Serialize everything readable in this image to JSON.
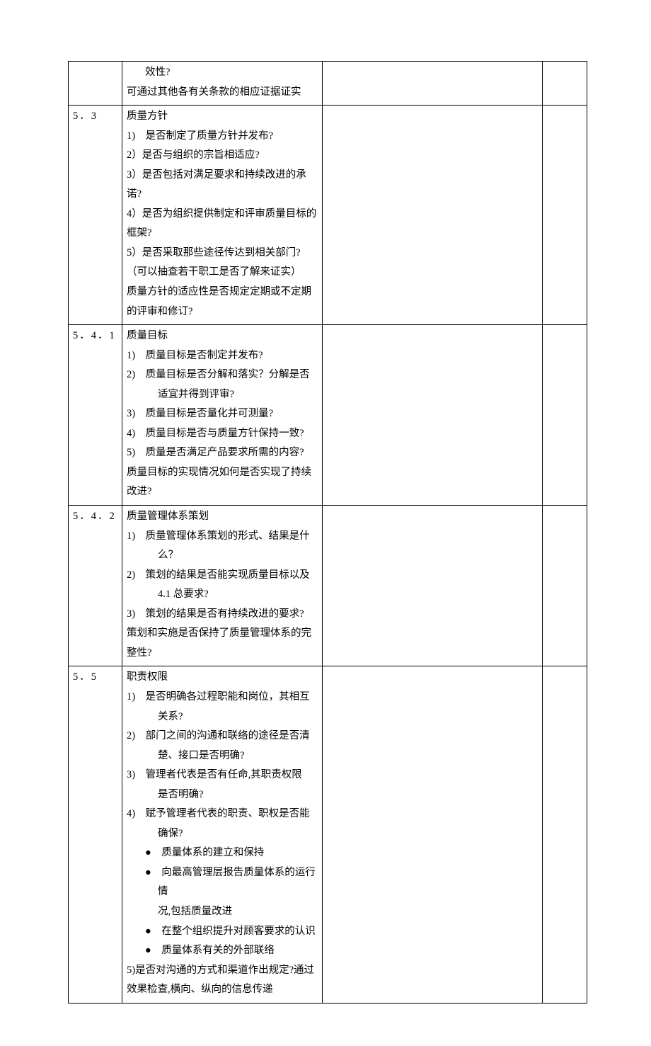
{
  "rows": [
    {
      "clause": "",
      "lines": [
        {
          "cls": "pad1",
          "t": "效性?"
        },
        {
          "cls": "noindent",
          "t": "可通过其他各有关条款的相应证据证实"
        }
      ]
    },
    {
      "clause": "5．3",
      "lines": [
        {
          "cls": "noindent",
          "t": "质量方针"
        },
        {
          "cls": "indent1",
          "t": "1)　是否制定了质量方针并发布?"
        },
        {
          "cls": "noindent",
          "t": "2）是否与组织的宗旨相适应?"
        },
        {
          "cls": "noindent",
          "t": "3）是否包括对满足要求和持续改进的承诺?"
        },
        {
          "cls": "noindent",
          "t": "4）是否为组织提供制定和评审质量目标的框架?"
        },
        {
          "cls": "noindent",
          "t": "5）是否采取那些途径传达到相关部门?"
        },
        {
          "cls": "noindent",
          "t": "（可以抽查若干职工是否了解来证实）"
        },
        {
          "cls": "noindent",
          "t": "质量方针的适应性是否规定定期或不定期的评审和修订?"
        }
      ]
    },
    {
      "clause": "5．4．1",
      "lines": [
        {
          "cls": "noindent",
          "t": "质量目标"
        },
        {
          "cls": "indent1",
          "t": "1)　质量目标是否制定并发布?"
        },
        {
          "cls": "indent1",
          "t": "2)　质量目标是否分解和落实？分解是否"
        },
        {
          "cls": "indent2",
          "t": "适宜并得到评审?"
        },
        {
          "cls": "indent1",
          "t": "3)　质量目标是否量化并可测量?"
        },
        {
          "cls": "indent1",
          "t": "4)　质量目标是否与质量方针保持一致?"
        },
        {
          "cls": "indent1",
          "t": "5)　质量是否满足产品要求所需的内容?"
        },
        {
          "cls": "noindent",
          "t": "质量目标的实现情况如何是否实现了持续改进?"
        }
      ]
    },
    {
      "clause": "5．4．2",
      "lines": [
        {
          "cls": "noindent",
          "t": "质量管理体系策划"
        },
        {
          "cls": "indent1",
          "t": "1)　质量管理体系策划的形式、结果是什"
        },
        {
          "cls": "indent2",
          "t": "么？"
        },
        {
          "cls": "indent1",
          "t": "2)　策划的结果是否能实现质量目标以及"
        },
        {
          "cls": "indent2",
          "t": "4.1 总要求?"
        },
        {
          "cls": "indent1",
          "t": "3)　策划的结果是否有持续改进的要求?"
        },
        {
          "cls": "noindent",
          "t": "策划和实施是否保持了质量管理体系的完整性?"
        }
      ]
    },
    {
      "clause": "5．5",
      "lines": [
        {
          "cls": "noindent",
          "t": "职责权限"
        },
        {
          "cls": "indent1",
          "t": "1)　是否明确各过程职能和岗位，其相互"
        },
        {
          "cls": "indent2",
          "t": "关系?"
        },
        {
          "cls": "indent1",
          "t": "2)　部门之间的沟通和联络的途径是否清"
        },
        {
          "cls": "indent2",
          "t": "楚、接口是否明确?"
        },
        {
          "cls": "indent1",
          "t": "3)　管理者代表是否有任命,其职责权限"
        },
        {
          "cls": "indent2",
          "t": "是否明确?"
        },
        {
          "cls": "indent1",
          "t": "4)　赋予管理者代表的职责、职权是否能"
        },
        {
          "cls": "indent2",
          "t": "确保?"
        },
        {
          "cls": "indent2hang",
          "t": "●　质量体系的建立和保持"
        },
        {
          "cls": "indent2hang",
          "t": "●　向最高管理层报告质量体系的运行情"
        },
        {
          "cls": "indent2",
          "t": "况,包括质量改进"
        },
        {
          "cls": "indent2hang",
          "t": "●　在整个组织提升对顾客要求的认识"
        },
        {
          "cls": "indent2hang",
          "t": "●　质量体系有关的外部联络"
        },
        {
          "cls": "noindent",
          "t": "5)是否对沟通的方式和渠道作出规定?通过效果检查,横向、纵向的信息传递"
        }
      ]
    }
  ]
}
